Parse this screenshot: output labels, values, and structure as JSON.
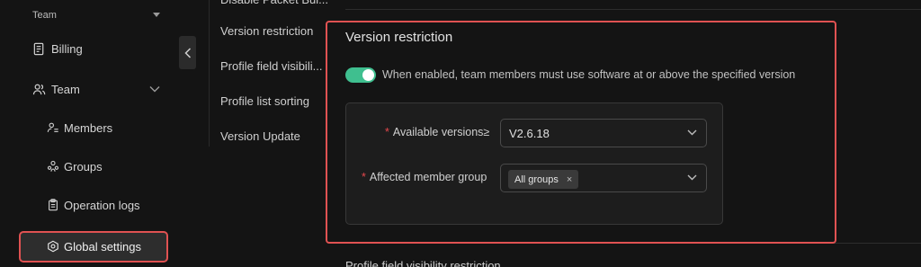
{
  "sidebar": {
    "team_label": "Team",
    "items": [
      {
        "label": "Billing",
        "icon": "billing-icon"
      },
      {
        "label": "Team",
        "icon": "team-icon"
      }
    ],
    "sub_items": [
      {
        "label": "Members",
        "icon": "members-icon"
      },
      {
        "label": "Groups",
        "icon": "groups-icon"
      },
      {
        "label": "Operation logs",
        "icon": "clipboard-icon"
      },
      {
        "label": "Global settings",
        "icon": "settings-hexagon-icon"
      }
    ]
  },
  "settings_menu": {
    "items": [
      "Version restriction",
      "Profile field visibili...",
      "Profile list sorting",
      "Version Update"
    ]
  },
  "version_restriction": {
    "title": "Version restriction",
    "toggle_description": "When enabled, team members must use software at or above the specified version",
    "available_versions_label": "Available versions≥",
    "available_versions_value": "V2.6.18",
    "affected_group_label": "Affected member group",
    "affected_group_tag": "All groups",
    "tag_remove": "×"
  },
  "colors": {
    "highlight_border": "#e05252",
    "toggle_on": "#3fbf8f",
    "required_star": "#e5484d"
  }
}
